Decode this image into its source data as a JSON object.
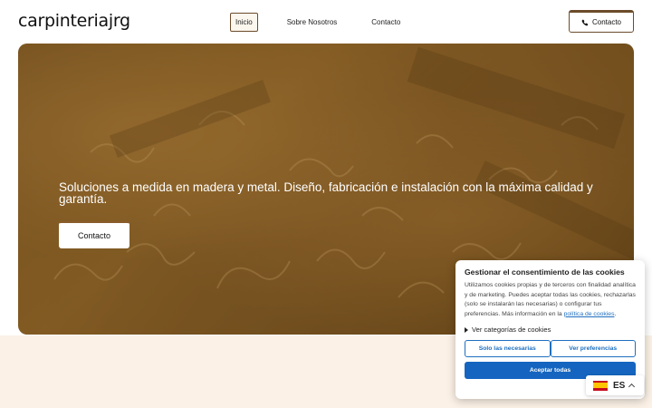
{
  "header": {
    "logo": "carpinteriajrg",
    "nav": [
      {
        "label": "Inicio",
        "active": true
      },
      {
        "label": "Sobre Nosotros",
        "active": false
      },
      {
        "label": "Contacto",
        "active": false
      }
    ],
    "cta_label": "Contacto",
    "cta_icon": "phone-icon"
  },
  "hero": {
    "text": "Soluciones a medida en madera y metal. Diseño, fabricación e instalación con la máxima calidad y garantía.",
    "cta_label": "Contacto",
    "accent": "#8a5c2a"
  },
  "cookie": {
    "title": "Gestionar el consentimiento de las cookies",
    "body": "Utilizamos cookies propias y de terceros con finalidad analítica y de marketing. Puedes aceptar todas las cookies, rechazarlas (solo se instalarán las necesarias) o configurar tus preferencias. Más información en la ",
    "link": "política de cookies",
    "body_end": ".",
    "categories": "Ver categorías de cookies",
    "btn_necessary": "Solo las necesarias",
    "btn_prefs": "Ver preferencias",
    "btn_accept": "Aceptar todas",
    "accent": "#1565c0"
  },
  "lang": {
    "code": "ES",
    "flag_icon": "spain-flag-icon"
  }
}
